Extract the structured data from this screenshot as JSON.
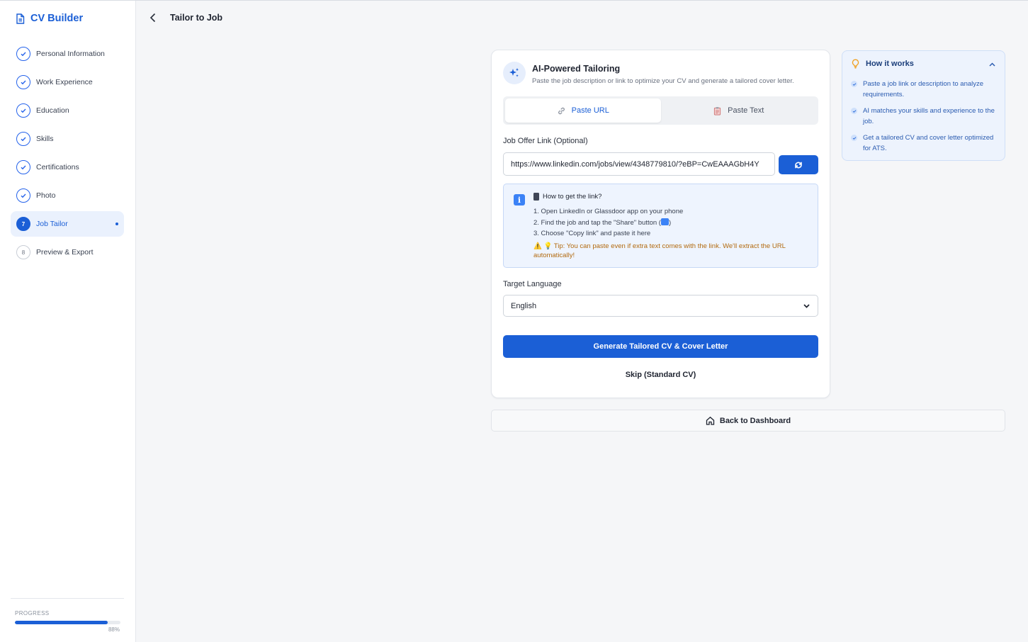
{
  "app": {
    "brand": "CV Builder"
  },
  "sidebar": {
    "items": [
      {
        "label": "Personal Information",
        "state": "done"
      },
      {
        "label": "Work Experience",
        "state": "done"
      },
      {
        "label": "Education",
        "state": "done"
      },
      {
        "label": "Skills",
        "state": "done"
      },
      {
        "label": "Certifications",
        "state": "done"
      },
      {
        "label": "Photo",
        "state": "done"
      },
      {
        "label": "Job Tailor",
        "state": "active",
        "number": "7"
      },
      {
        "label": "Preview & Export",
        "state": "pending",
        "number": "8"
      }
    ],
    "progress": {
      "label": "PROGRESS",
      "value": 88,
      "text": "88%"
    }
  },
  "header": {
    "title": "Tailor to Job"
  },
  "card": {
    "title": "AI-Powered Tailoring",
    "subtitle": "Paste the job description or link to optimize your CV and generate a tailored cover letter.",
    "tabs": [
      {
        "label": "Paste URL",
        "active": true
      },
      {
        "label": "Paste Text",
        "active": false
      }
    ],
    "link_label": "Job Offer Link (Optional)",
    "link_value": "https://www.linkedin.com/jobs/view/4348779810/?eBP=CwEAAAGbH4Y",
    "info": {
      "icon": "i",
      "title": "How to get the link?",
      "steps": [
        "1. Open LinkedIn or Glassdoor app on your phone",
        "2. Find the job and tap the \"Share\" button (",
        "3. Choose \"Copy link\" and paste it here"
      ],
      "step2_suffix": ")",
      "tip": "⚠️ 💡 Tip: You can paste even if extra text comes with the link. We'll extract the URL automatically!"
    },
    "language_label": "Target Language",
    "language_value": "English",
    "generate_label": "Generate Tailored CV & Cover Letter",
    "skip_label": "Skip (Standard CV)"
  },
  "dashboard_label": "Back to Dashboard",
  "how_it_works": {
    "title": "How it works",
    "items": [
      "Paste a job link or description to analyze requirements.",
      "AI matches your skills and experience to the job.",
      "Get a tailored CV and cover letter optimized for ATS."
    ]
  },
  "colors": {
    "accent": "#1b5fd6",
    "info_bg": "#eef4fe",
    "tip": "#b26a0f"
  }
}
